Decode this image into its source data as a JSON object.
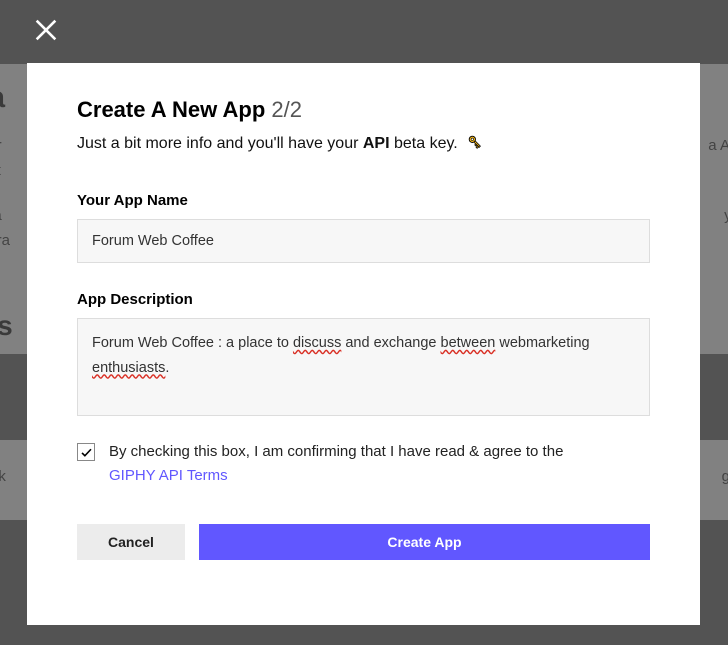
{
  "background": {
    "heading1": "oa",
    "p1": "our ",
    "p1_right": "a AP",
    "p2": "bet",
    "p3": "rea",
    "p3_right": "yo",
    "p4": "ogra",
    "heading2": "ps",
    "pb_left": "s lik",
    "pb_right": "g yo"
  },
  "modal": {
    "title": "Create A New App",
    "step": "2/2",
    "subtitle_pre": "Just a bit more info and you'll have your ",
    "subtitle_strong": "API",
    "subtitle_post": " beta key. ",
    "app_name_label": "Your App Name",
    "app_name_value": "Forum Web Coffee",
    "description_label": "App Description",
    "description_value": "Forum Web Coffee : a place to discuss and exchange between webmarketing enthusiasts.",
    "consent_text": "By checking this box, I am confirming that I have read & agree to the ",
    "consent_link": "GIPHY API Terms",
    "cancel_label": "Cancel",
    "create_label": "Create App"
  }
}
